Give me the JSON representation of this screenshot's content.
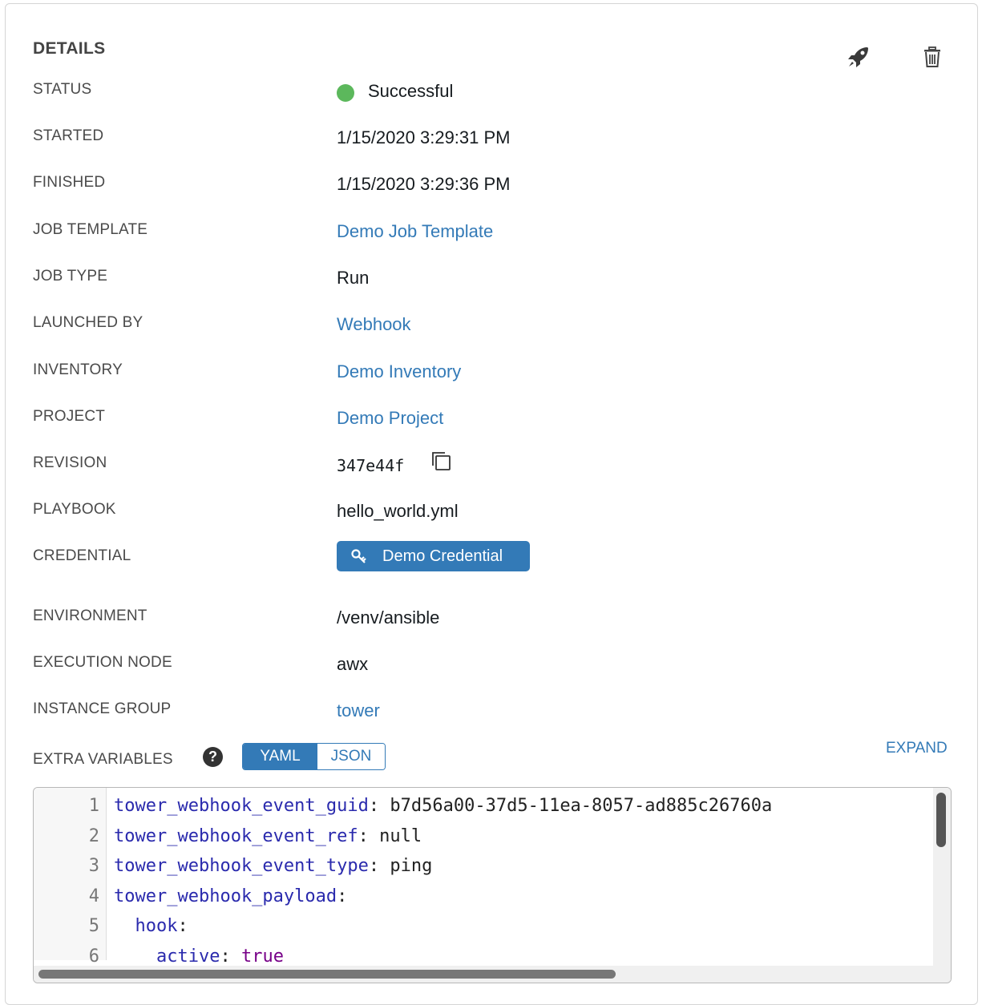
{
  "details": {
    "title": "DETAILS",
    "launch_icon": "rocket-icon",
    "delete_icon": "trash-icon"
  },
  "fields": {
    "status": {
      "label": "STATUS",
      "value": "Successful",
      "color": "#5cb85c"
    },
    "started": {
      "label": "STARTED",
      "value": "1/15/2020 3:29:31 PM"
    },
    "finished": {
      "label": "FINISHED",
      "value": "1/15/2020 3:29:36 PM"
    },
    "job_template": {
      "label": "JOB TEMPLATE",
      "value": "Demo Job Template"
    },
    "job_type": {
      "label": "JOB TYPE",
      "value": "Run"
    },
    "launched_by": {
      "label": "LAUNCHED BY",
      "value": "Webhook"
    },
    "inventory": {
      "label": "INVENTORY",
      "value": "Demo Inventory"
    },
    "project": {
      "label": "PROJECT",
      "value": "Demo Project"
    },
    "revision": {
      "label": "REVISION",
      "value": "347e44f"
    },
    "playbook": {
      "label": "PLAYBOOK",
      "value": "hello_world.yml"
    },
    "credential": {
      "label": "CREDENTIAL",
      "value": "Demo Credential"
    },
    "environment": {
      "label": "ENVIRONMENT",
      "value": "/venv/ansible"
    },
    "execution_node": {
      "label": "EXECUTION NODE",
      "value": "awx"
    },
    "instance_group": {
      "label": "INSTANCE GROUP",
      "value": "tower"
    }
  },
  "extra_vars": {
    "label": "EXTRA VARIABLES",
    "help": "?",
    "toggle": {
      "yaml": "YAML",
      "json": "JSON",
      "selected": "YAML"
    },
    "expand": "EXPAND",
    "lines": [
      {
        "n": "1",
        "key": "tower_webhook_event_guid",
        "sep": ": ",
        "val": "b7d56a00-37d5-11ea-8057-ad885c26760a",
        "indent": ""
      },
      {
        "n": "2",
        "key": "tower_webhook_event_ref",
        "sep": ": ",
        "val": "null",
        "indent": ""
      },
      {
        "n": "3",
        "key": "tower_webhook_event_type",
        "sep": ": ",
        "val": "ping",
        "indent": ""
      },
      {
        "n": "4",
        "key": "tower_webhook_payload",
        "sep": ":",
        "val": "",
        "indent": ""
      },
      {
        "n": "5",
        "key": "hook",
        "sep": ":",
        "val": "",
        "indent": "  "
      },
      {
        "n": "6",
        "key": "active",
        "sep": ": ",
        "val": "true",
        "indent": "    "
      }
    ]
  },
  "colors": {
    "link": "#337ab7",
    "success": "#5cb85c"
  }
}
